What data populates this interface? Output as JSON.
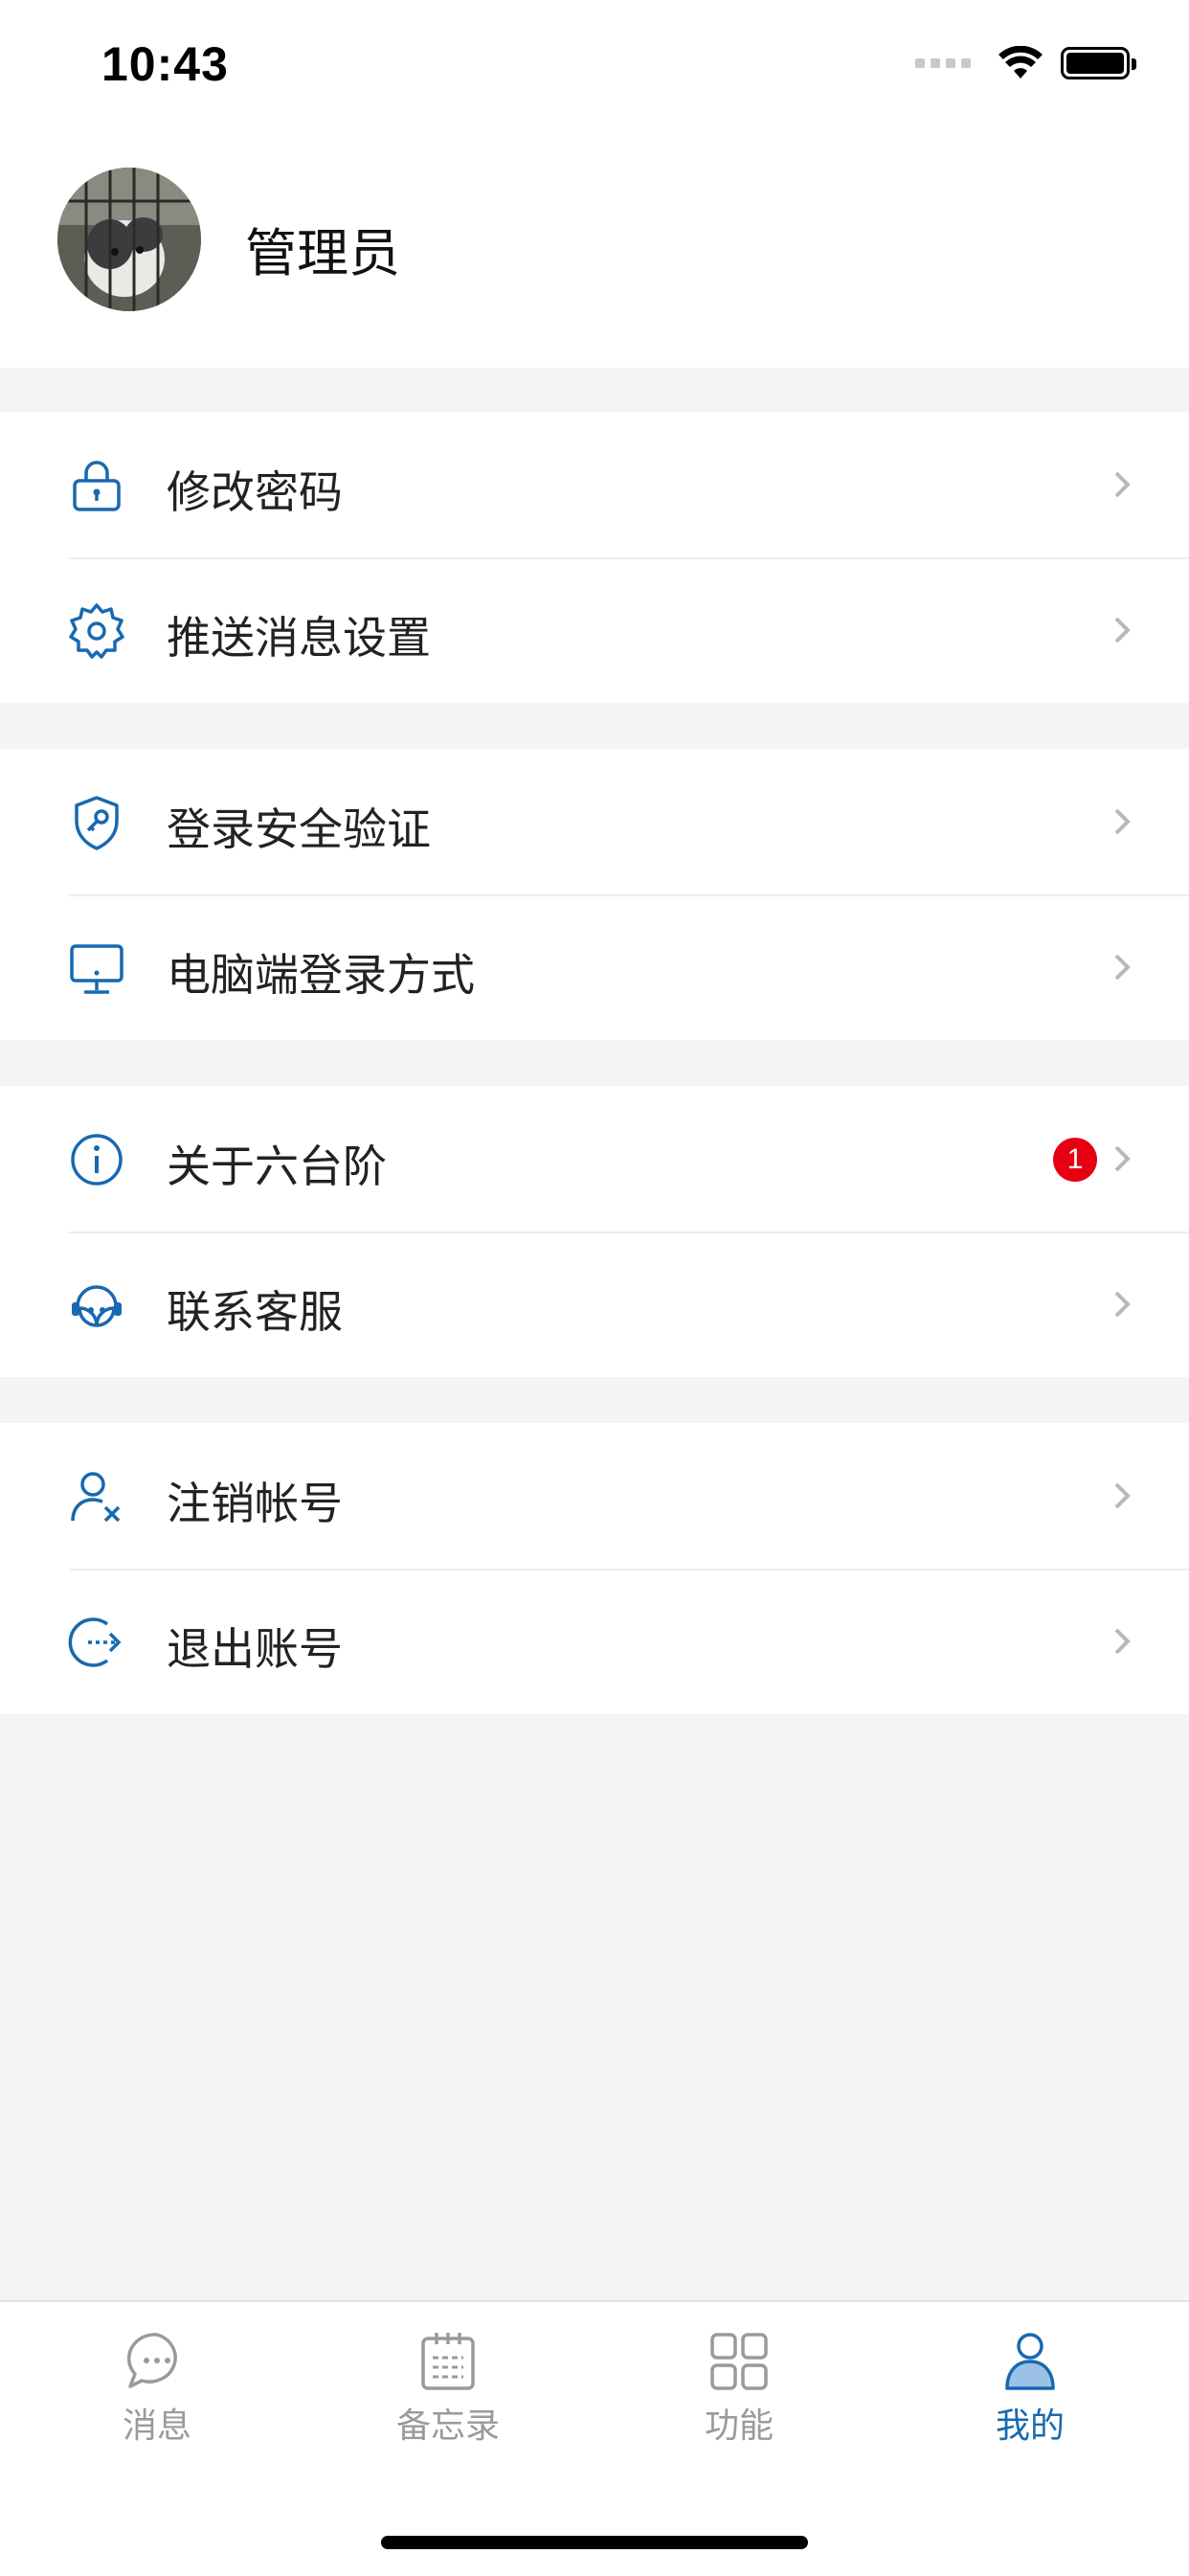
{
  "status_bar": {
    "time": "10:43"
  },
  "profile": {
    "name": "管理员"
  },
  "menu": {
    "groups": [
      {
        "items": [
          {
            "label": "修改密码",
            "icon": "lock-icon"
          },
          {
            "label": "推送消息设置",
            "icon": "gear-icon"
          }
        ]
      },
      {
        "items": [
          {
            "label": "登录安全验证",
            "icon": "shield-key-icon"
          },
          {
            "label": "电脑端登录方式",
            "icon": "monitor-icon"
          }
        ]
      },
      {
        "items": [
          {
            "label": "关于六台阶",
            "icon": "info-icon",
            "badge": "1"
          },
          {
            "label": "联系客服",
            "icon": "headset-icon"
          }
        ]
      },
      {
        "items": [
          {
            "label": "注销帐号",
            "icon": "user-remove-icon"
          },
          {
            "label": "退出账号",
            "icon": "logout-icon"
          }
        ]
      }
    ]
  },
  "tabbar": {
    "tabs": [
      {
        "label": "消息",
        "icon": "chat-bubble-icon",
        "active": false
      },
      {
        "label": "备忘录",
        "icon": "calendar-note-icon",
        "active": false
      },
      {
        "label": "功能",
        "icon": "grid-icon",
        "active": false
      },
      {
        "label": "我的",
        "icon": "person-icon",
        "active": true
      }
    ]
  },
  "colors": {
    "accent": "#1769b0",
    "badge": "#e60012",
    "background": "#f4f4f4",
    "inactive_tab": "#9a9a9a"
  }
}
